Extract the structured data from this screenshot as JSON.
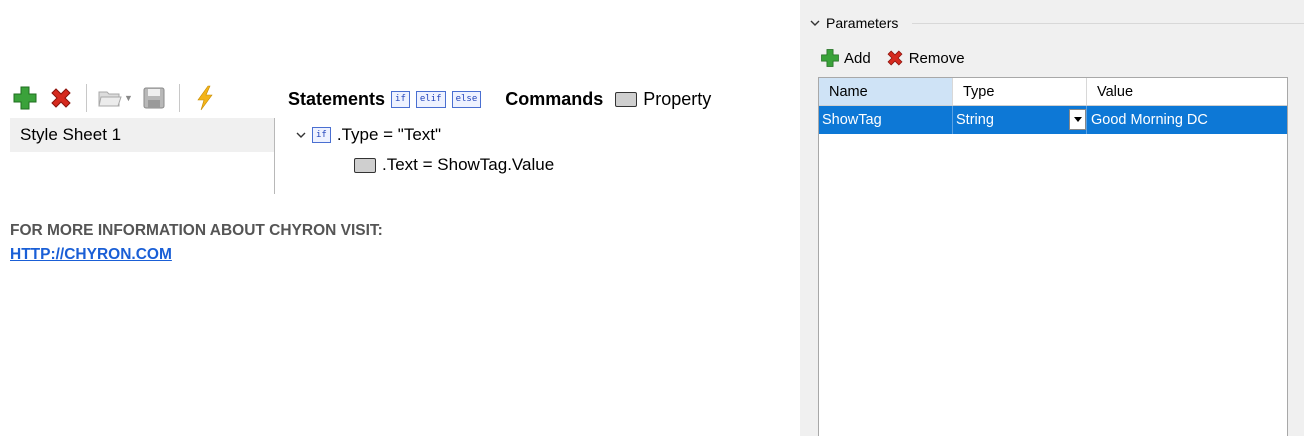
{
  "editor": {
    "toolbar": {
      "buttons": [
        {
          "name": "add-icon"
        },
        {
          "name": "remove-icon"
        },
        {
          "name": "open-icon"
        },
        {
          "name": "save-icon"
        },
        {
          "name": "lightning-icon"
        }
      ]
    },
    "style_sheets": [
      "Style Sheet 1"
    ],
    "statements_label": "Statements",
    "keywords": [
      "if",
      "elif",
      "else"
    ],
    "commands_label": "Commands",
    "property_label": "Property",
    "tree": {
      "if_keyword": "if",
      "condition": ".Type = \"Text\"",
      "child": ".Text = ShowTag.Value"
    }
  },
  "info": {
    "text": "FOR MORE INFORMATION ABOUT CHYRON VISIT:",
    "link": "HTTP://CHYRON.COM"
  },
  "parameters": {
    "title": "Parameters",
    "add_label": "Add",
    "remove_label": "Remove",
    "columns": [
      "Name",
      "Type",
      "Value"
    ],
    "rows": [
      {
        "name": "ShowTag",
        "type": "String",
        "value": "Good Morning DC"
      }
    ]
  },
  "colors": {
    "selection": "#0d78d6",
    "header_highlight": "#cfe3f6",
    "link": "#1a5fd6"
  }
}
